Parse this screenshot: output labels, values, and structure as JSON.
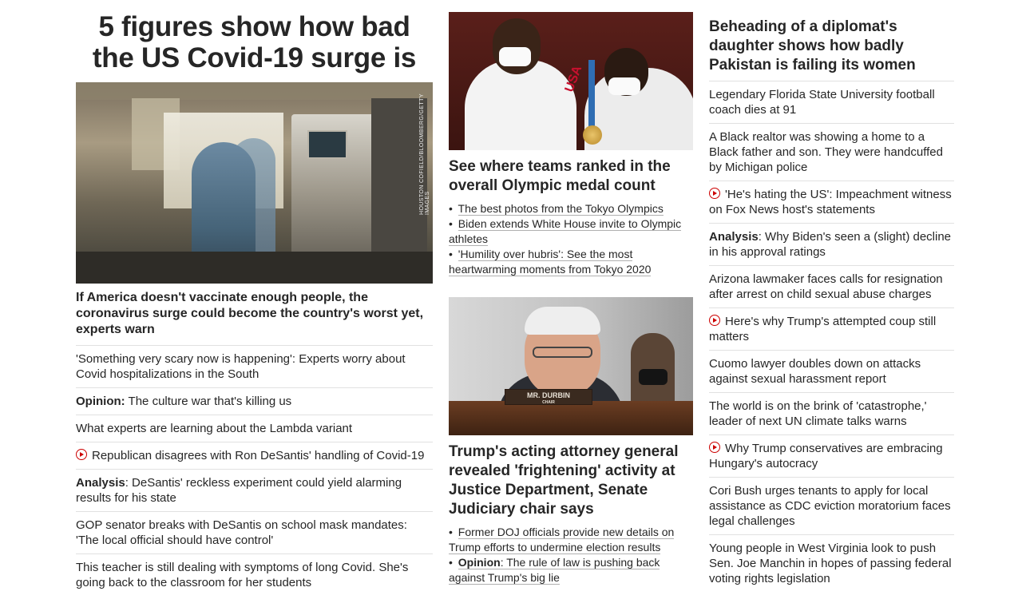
{
  "col1": {
    "headline": "5 figures show how bad the US Covid-19 surge is",
    "hero_credit": "HOUSTON COFIELD/BLOOMBERG/GETTY IMAGES",
    "hero_caption": "If America doesn't vaccinate enough people, the coronavirus surge could become the country's worst yet, experts warn",
    "items": [
      {
        "text": "'Something very scary now is happening': Experts worry about Covid hospitalizations in the South"
      },
      {
        "label": "Opinion:",
        "text": " The culture war that's killing us"
      },
      {
        "text": "What experts are learning about the Lambda variant"
      },
      {
        "video": true,
        "text": "Republican disagrees with Ron DeSantis' handling of Covid-19"
      },
      {
        "label": "Analysis",
        "text": ": DeSantis' reckless experiment could yield alarming results for his state"
      },
      {
        "text": "GOP senator breaks with DeSantis on school mask mandates: 'The local official should have control'"
      },
      {
        "text": "This teacher is still dealing with symptoms of long Covid. She's going back to the classroom for her students"
      }
    ]
  },
  "col2": {
    "story1": {
      "title": "See where teams ranked in the overall Olympic medal count",
      "image_text": "USA",
      "links": [
        {
          "text": "The best photos from the Tokyo Olympics"
        },
        {
          "text": "Biden extends White House invite to Olympic athletes"
        },
        {
          "text": "'Humility over hubris': See the most heartwarming moments from Tokyo 2020"
        }
      ]
    },
    "story2": {
      "title": "Trump's acting attorney general revealed 'frightening' activity at Justice Department, Senate Judiciary chair says",
      "nameplate": "MR. DURBIN",
      "nameplate_sub": "CHAIR",
      "links": [
        {
          "text": "Former DOJ officials provide new details on Trump efforts to undermine election results"
        },
        {
          "label": "Opinion",
          "text": ": The rule of law is pushing back against Trump's big lie"
        }
      ]
    }
  },
  "col3": {
    "headline": "Beheading of a diplomat's daughter shows how badly Pakistan is failing its women",
    "items": [
      {
        "text": "Legendary Florida State University football coach dies at 91"
      },
      {
        "text": "A Black realtor was showing a home to a Black father and son. They were handcuffed by Michigan police"
      },
      {
        "video": true,
        "text": "'He's hating the US': Impeachment witness on Fox News host's statements"
      },
      {
        "label": "Analysis",
        "text": ": Why Biden's seen a (slight) decline in his approval ratings"
      },
      {
        "text": "Arizona lawmaker faces calls for resignation after arrest on child sexual abuse charges"
      },
      {
        "video": true,
        "text": "Here's why Trump's attempted coup still matters"
      },
      {
        "text": "Cuomo lawyer doubles down on attacks against sexual harassment report"
      },
      {
        "text": "The world is on the brink of 'catastrophe,' leader of next UN climate talks warns"
      },
      {
        "video": true,
        "text": "Why Trump conservatives are embracing Hungary's autocracy"
      },
      {
        "text": "Cori Bush urges tenants to apply for local assistance as CDC eviction moratorium faces legal challenges"
      },
      {
        "text": "Young people in West Virginia look to push Sen. Joe Manchin in hopes of passing federal voting rights legislation"
      }
    ]
  },
  "colors": {
    "text": "#262626",
    "divider": "#e1e1e1",
    "video_icon": "#cc0000"
  },
  "icons": {
    "video": "play-circle-icon"
  }
}
